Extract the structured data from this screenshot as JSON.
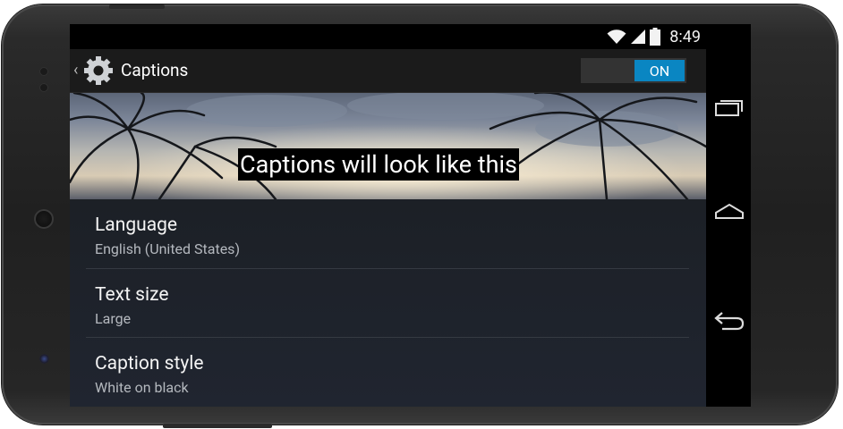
{
  "status_bar": {
    "time": "8:49",
    "icons": [
      "wifi-icon",
      "signal-icon",
      "battery-icon"
    ]
  },
  "action_bar": {
    "title": "Captions",
    "icon": "settings-gear-icon",
    "switch_label": "ON",
    "switch_state": "on",
    "accent_color": "#0a86c2"
  },
  "preview": {
    "caption_text": "Captions will look like this"
  },
  "settings": {
    "items": [
      {
        "title": "Language",
        "summary": "English (United States)"
      },
      {
        "title": "Text size",
        "summary": "Large"
      },
      {
        "title": "Caption style",
        "summary": "White on black"
      }
    ]
  },
  "nav_bar": {
    "buttons": [
      "recent-apps-icon",
      "home-icon",
      "back-icon"
    ]
  }
}
